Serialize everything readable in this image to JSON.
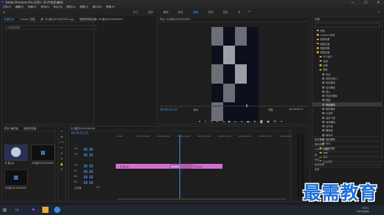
{
  "window": {
    "title": "Adobe Premiere Pro 2020 - D:\\严思思\\最终\\",
    "controls": [
      "—",
      "☐",
      "✕"
    ]
  },
  "menu": [
    "文件(F)",
    "编辑(E)",
    "剪辑(C)",
    "序列(S)",
    "标记(M)",
    "图形(G)",
    "视图(V)",
    "窗口(W)",
    "帮助(H)"
  ],
  "workspaces": {
    "tabs": [
      "学习",
      "组件",
      "编辑",
      "颜色",
      "效果",
      "音频",
      "图形",
      "库"
    ],
    "active_index": 4
  },
  "source_panel": {
    "tabs": [
      "效果控件",
      "Lumetri 范围",
      "源: 02(爱天)010000000.jpg",
      "音频剪辑混合器: 02(爱天)010000000"
    ],
    "info": "(未选择剪辑)"
  },
  "program_monitor": {
    "title": "节目: 02(爱天)010000000",
    "timecode_left": "00:00:03:12",
    "fit": "适合",
    "quality": "完整",
    "timecode_right": "00:00:05:11",
    "transport_buttons": [
      "marker",
      "in-point",
      "out-point",
      "go-to-in",
      "step-back",
      "play",
      "step-forward",
      "go-to-out",
      "lift",
      "extract",
      "export-frame",
      "compare",
      "settings",
      "add"
    ]
  },
  "effects_panel": {
    "title": "效果",
    "items": [
      {
        "label": "预设",
        "kind": "folder",
        "indent": 1
      },
      {
        "label": "Lumetri 预设",
        "kind": "folder",
        "indent": 1
      },
      {
        "label": "音频效果",
        "kind": "folder",
        "indent": 1
      },
      {
        "label": "音频过渡",
        "kind": "folder",
        "indent": 1
      },
      {
        "label": "视频效果",
        "kind": "folder",
        "indent": 1
      },
      {
        "label": "视频过渡",
        "kind": "folder",
        "indent": 1
      },
      {
        "label": "3D 运动",
        "kind": "folder",
        "indent": 2
      },
      {
        "label": "内滑",
        "kind": "folder",
        "indent": 2
      },
      {
        "label": "划像",
        "kind": "folder",
        "indent": 2
      },
      {
        "label": "擦除",
        "kind": "folder",
        "indent": 2
      },
      {
        "label": "划出",
        "kind": "effect",
        "indent": 3
      },
      {
        "label": "双侧平推门",
        "kind": "effect",
        "indent": 3
      },
      {
        "label": "带状擦除",
        "kind": "effect",
        "indent": 3
      },
      {
        "label": "径向擦除",
        "kind": "effect",
        "indent": 3
      },
      {
        "label": "插入",
        "kind": "effect",
        "indent": 3
      },
      {
        "label": "时钟式擦除",
        "kind": "effect",
        "indent": 3
      },
      {
        "label": "棋盘",
        "kind": "effect",
        "indent": 3
      },
      {
        "label": "棋盘擦除",
        "kind": "effect",
        "indent": 3,
        "selected": true
      },
      {
        "label": "楔形擦除",
        "kind": "effect",
        "indent": 3
      },
      {
        "label": "水波块",
        "kind": "effect",
        "indent": 3
      },
      {
        "label": "油漆飞溅",
        "kind": "effect",
        "indent": 3
      },
      {
        "label": "渐变擦除",
        "kind": "effect",
        "indent": 3
      },
      {
        "label": "百叶窗",
        "kind": "effect",
        "indent": 3
      },
      {
        "label": "螺旋框",
        "kind": "effect",
        "indent": 3
      },
      {
        "label": "随机块",
        "kind": "effect",
        "indent": 3
      },
      {
        "label": "随机擦除",
        "kind": "effect",
        "indent": 3
      },
      {
        "label": "风车",
        "kind": "effect",
        "indent": 3
      },
      {
        "label": "沉浸式视频",
        "kind": "folder",
        "indent": 2
      },
      {
        "label": "溶解",
        "kind": "folder",
        "indent": 2
      },
      {
        "label": "缩放",
        "kind": "folder",
        "indent": 2
      },
      {
        "label": "页面剥落",
        "kind": "folder",
        "indent": 2
      }
    ],
    "bottom_sections": [
      "基本图形",
      "基本声音",
      "Lumetri 颜色",
      "库",
      "标记",
      "历史记录",
      "信息"
    ]
  },
  "project_panel": {
    "tabs": [
      "项目: 最终版",
      "媒体浏览器"
    ],
    "items": [
      {
        "label": "天 爱.jpg"
      },
      {
        "label": "02(爱天)010000000"
      },
      {
        "label": "02(爱天)010000000"
      }
    ]
  },
  "timeline": {
    "tab": "02(爱天)010000000",
    "timecode": "00:00:03:12",
    "ruler_labels": [
      "00:00",
      "00:00:01:00",
      "00:00:02:00",
      "00:00:03:00",
      "00:00:04:00",
      "00:00:05:00",
      "00:00:06:00",
      "00:00:07:00",
      "00:00:08:00"
    ],
    "tracks": [
      {
        "name": "V3"
      },
      {
        "name": "V2"
      },
      {
        "name": "V1"
      },
      {
        "name": "A1"
      },
      {
        "name": "A2"
      },
      {
        "name": "A3"
      },
      {
        "name": "主声道"
      }
    ],
    "master_value": "0.0",
    "clip_a": "天 爱.jpg",
    "transition": "棋盘擦除",
    "clip_b": "天 爱.jpg"
  },
  "taskbar": {
    "time": "13:11",
    "date": "2021/6/28"
  },
  "watermark": "最需教育"
}
